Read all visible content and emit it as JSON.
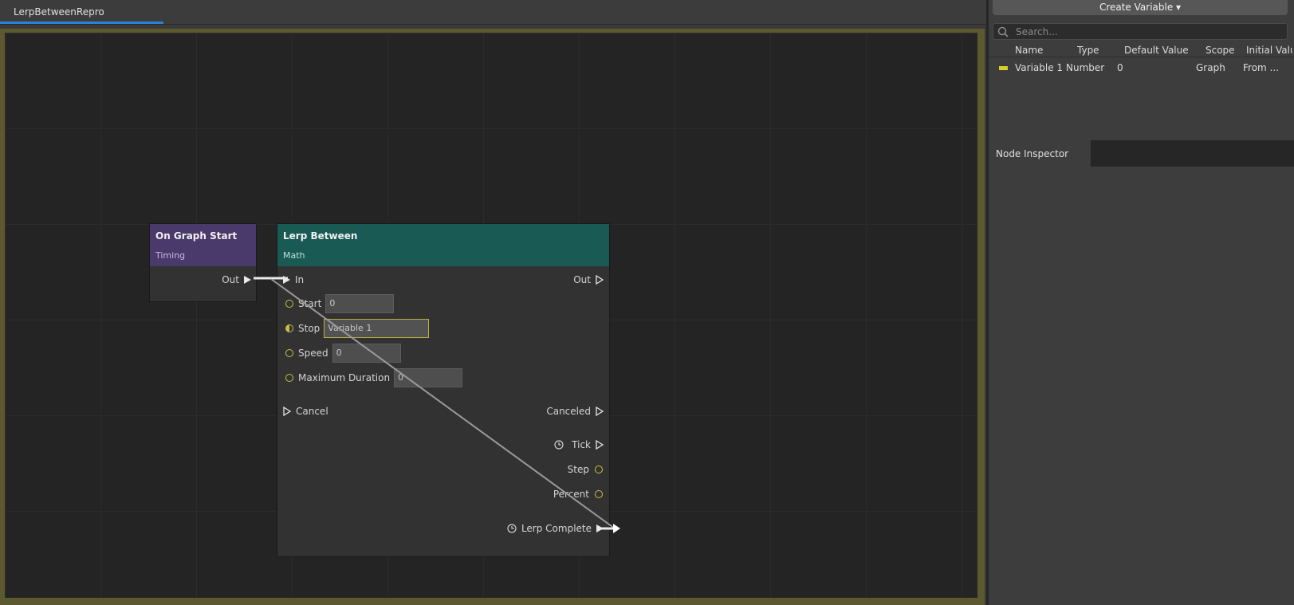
{
  "tab": {
    "title": "LerpBetweenRepro"
  },
  "nodes": {
    "start": {
      "title": "On Graph Start",
      "subtitle": "Timing",
      "out_label": "Out"
    },
    "lerp": {
      "title": "Lerp Between",
      "subtitle": "Math",
      "in_label": "In",
      "out_label": "Out",
      "start_label": "Start",
      "start_value": "0",
      "stop_label": "Stop",
      "stop_value": "Variable 1",
      "speed_label": "Speed",
      "speed_value": "0",
      "maxdur_label": "Maximum Duration",
      "maxdur_value": "0",
      "cancel_label": "Cancel",
      "canceled_label": "Canceled",
      "tick_label": "Tick",
      "step_label": "Step",
      "percent_label": "Percent",
      "complete_label": "Lerp Complete"
    }
  },
  "variables": {
    "create_label": "Create Variable ▾",
    "search_placeholder": "Search...",
    "columns": {
      "name": "Name",
      "type": "Type",
      "default": "Default Value",
      "scope": "Scope",
      "initial": "Initial Value"
    },
    "rows": [
      {
        "name": "Variable 1",
        "type": "Number",
        "default": "0",
        "scope": "Graph",
        "initial": "From ..."
      }
    ]
  },
  "inspector": {
    "tab_label": "Node Inspector"
  },
  "colors": {
    "accent": "#2a84d6",
    "start_header": "#4a3a6c",
    "lerp_header": "#1a5a54",
    "number_var": "#d6cf28"
  }
}
